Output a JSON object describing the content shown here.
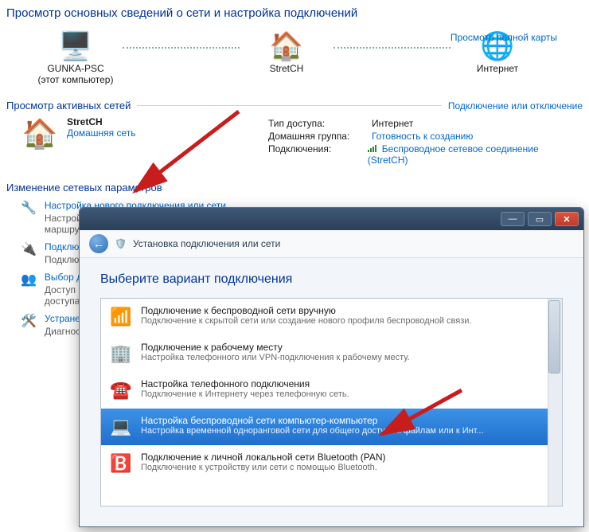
{
  "header": {
    "title": "Просмотр основных сведений о сети и настройка подключений"
  },
  "map": {
    "this_pc": "GUNKA-PSC",
    "this_pc_sub": "(этот компьютер)",
    "router": "StretCH",
    "internet": "Интернет",
    "view_full": "Просмотр полной карты"
  },
  "active": {
    "heading": "Просмотр активных сетей",
    "action": "Подключение или отключение",
    "network_name": "StretCH",
    "network_type": "Домашняя сеть",
    "labels": {
      "access": "Тип доступа:",
      "homegroup": "Домашняя группа:",
      "connections": "Подключения:"
    },
    "values": {
      "access": "Интернет",
      "homegroup": "Готовность к созданию",
      "connections": "Беспроводное сетевое соединение (StretCH)"
    }
  },
  "change": {
    "heading": "Изменение сетевых параметров",
    "tasks": [
      {
        "link": "Настройка нового подключения или сети",
        "desc": "Настройка беспроводного, широкополосного, модемного, прямого или VPN-подключения или же настройка маршрутизатора или точки доступа."
      },
      {
        "link": "Подключиться к сети",
        "desc": "Подключение или повторное подключение к беспроводному, проводному, модемному сетевому соединению или VPN."
      },
      {
        "link": "Выбор домашней группы и параметров общего доступа",
        "desc": "Доступ к файлам и принтерам, расположенным на других сетевых компьютерах, или изменение параметров общего доступа."
      },
      {
        "link": "Устранение неполадок",
        "desc": "Диагностика и исправление сетевых проблем или получение сведений об устранении."
      }
    ]
  },
  "wizard": {
    "crumb": "Установка подключения или сети",
    "title": "Выберите вариант подключения",
    "options": [
      {
        "t": "Подключение к беспроводной сети вручную",
        "d": "Подключение к скрытой сети или создание нового профиля беспроводной связи."
      },
      {
        "t": "Подключение к рабочему месту",
        "d": "Настройка телефонного или VPN-подключения к рабочему месту."
      },
      {
        "t": "Настройка телефонного подключения",
        "d": "Подключение к Интернету через телефонную сеть."
      },
      {
        "t": "Настройка беспроводной сети компьютер-компьютер",
        "d": "Настройка временной одноранговой сети для общего доступа к файлам или к Инт..."
      },
      {
        "t": "Подключение к личной локальной сети Bluetooth (PAN)",
        "d": "Подключение к устройству или сети с помощью Bluetooth."
      }
    ]
  }
}
